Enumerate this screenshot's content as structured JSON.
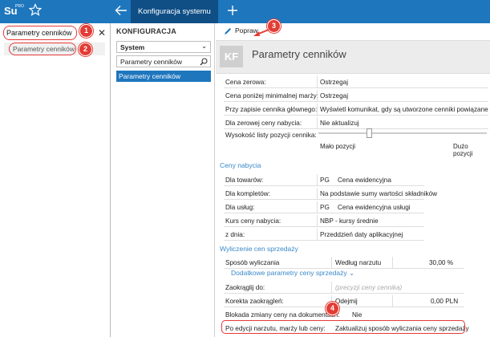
{
  "app": {
    "logo": "Su",
    "logo_sup": "PRO",
    "tab_title": "Konfiguracja systemu"
  },
  "left": {
    "search_value": "Parametry cenników",
    "result_label": "Parametry cenników"
  },
  "config": {
    "title": "KONFIGURACJA",
    "select_value": "System",
    "search_value": "Parametry cenników",
    "selected_item": "Parametry cenników"
  },
  "toolbar": {
    "popraw_label": "Popraw"
  },
  "page": {
    "badge": "KF",
    "title": "Parametry cenników"
  },
  "general": {
    "rows": [
      {
        "label": "Cena zerowa:",
        "value": "Ostrzegaj"
      },
      {
        "label": "Cena poniżej minimalnej marży:",
        "value": "Ostrzegaj"
      },
      {
        "label": "Przy zapisie cennika głównego:",
        "value": "Wyświetl komunikat, gdy są utworzone cenniki powiązane"
      },
      {
        "label": "Dla zerowej ceny nabycia:",
        "value": "Nie aktualizuj"
      }
    ],
    "slider_label": "Wysokość listy pozycji cennika:",
    "slider_min": "Mało pozycji",
    "slider_max": "Dużo pozycji",
    "slider_level": 0.3
  },
  "ceny_nabycia": {
    "title": "Ceny nabycia",
    "rows": [
      {
        "label": "Dla towarów:",
        "code": "PG",
        "value": "Cena ewidencyjna"
      },
      {
        "label": "Dla kompletów:",
        "code": "",
        "value": "Na podstawie sumy wartości składników"
      },
      {
        "label": "Dla usług:",
        "code": "PG",
        "value": "Cena ewidencyjna usługi"
      },
      {
        "label": "Kurs ceny nabycia:",
        "code": "",
        "value": "NBP - kursy średnie"
      },
      {
        "label": "z dnia:",
        "code": "",
        "value": "Przeddzień daty aplikacyjnej"
      }
    ]
  },
  "wyliczenie": {
    "title": "Wyliczenie cen sprzedaży",
    "sposob_label": "Sposób wyliczania",
    "sposob_value": "Według narzutu",
    "sposob_pct": "30,00 %",
    "dodatkowe": "Dodatkowe parametry ceny sprzedaży",
    "zaokraglij_label": "Zaokrąglij do:",
    "zaokraglij_placeholder": "(precyzji ceny cennika)",
    "korekta_label": "Korekta zaokrągleń:",
    "korekta_mode": "Odejmij",
    "korekta_value": "0,00 PLN",
    "blokada_label": "Blokada zmiany ceny na dokumentach:",
    "blokada_value": "Nie",
    "po_edycji_label": "Po edycji narzutu, marży lub ceny:",
    "po_edycji_value": "Zaktualizuj sposób wyliczania ceny sprzedaży"
  },
  "callouts": [
    "1",
    "2",
    "3",
    "4"
  ],
  "colors": {
    "topbar": "#1e76bd",
    "tab_active": "#0f4f86",
    "callout": "#e23c34",
    "section": "#3a88c8"
  }
}
